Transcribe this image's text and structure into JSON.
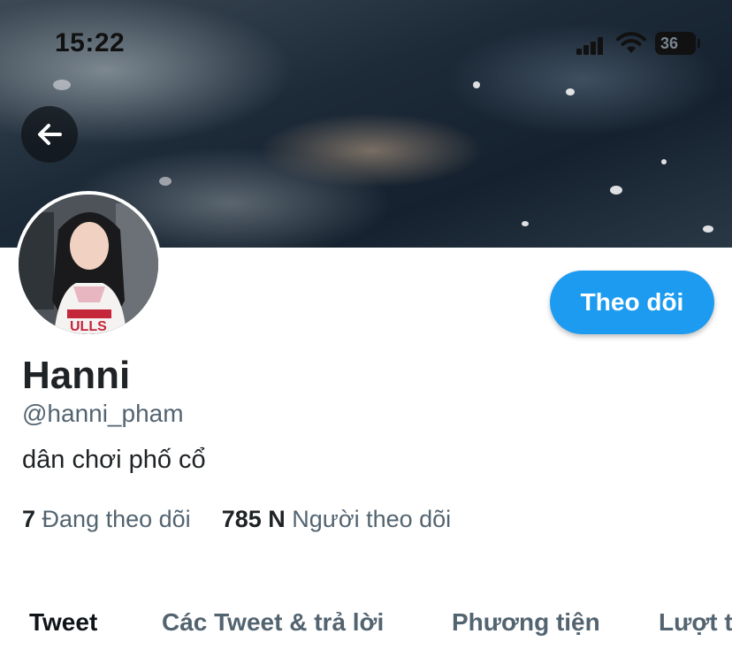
{
  "status_bar": {
    "time": "15:22",
    "battery": "36",
    "icons": [
      "signal-icon",
      "wifi-icon",
      "battery-icon"
    ]
  },
  "header": {
    "back_icon": "arrow-left-icon"
  },
  "profile": {
    "name": "Hanni",
    "handle": "@hanni_pham",
    "bio": "dân chơi phố cổ",
    "follow_label": "Theo dõi",
    "following_count": "7",
    "following_label": "Đang theo dõi",
    "followers_count": "785 N",
    "followers_label": "Người theo dõi"
  },
  "tabs": [
    {
      "label": "Tweet",
      "active": true
    },
    {
      "label": "Các Tweet & trả lời",
      "active": false
    },
    {
      "label": "Phương tiện",
      "active": false
    },
    {
      "label": "Lượt t",
      "active": false
    }
  ],
  "colors": {
    "accent": "#1d9bf0",
    "text_primary": "#0f1419",
    "text_secondary": "#536471"
  }
}
